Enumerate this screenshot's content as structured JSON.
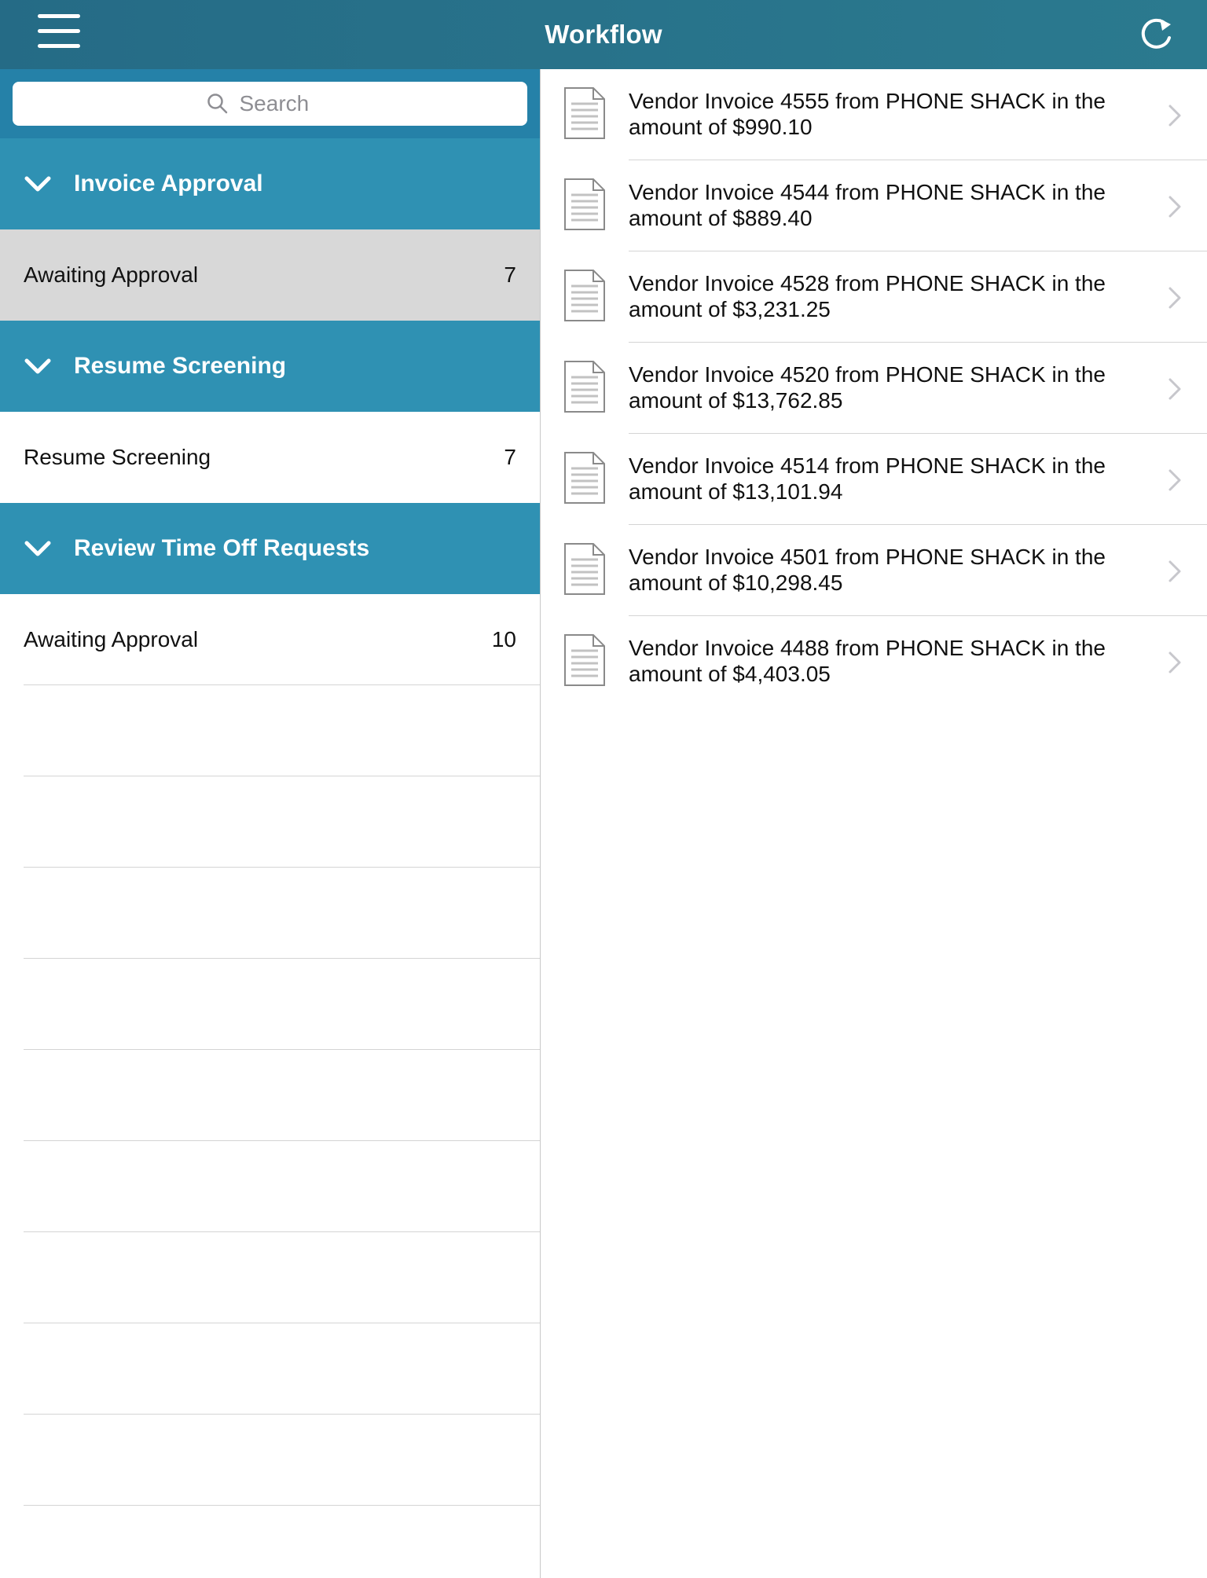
{
  "header": {
    "title": "Workflow",
    "menu_icon": "hamburger-menu-icon",
    "refresh_icon": "refresh-icon"
  },
  "colors": {
    "header": "#256b86",
    "search_bar": "#2581a8",
    "group_header": "#2f91b3",
    "selected_row": "#d8d8d8"
  },
  "sidebar": {
    "search": {
      "placeholder": "Search"
    },
    "groups": [
      {
        "label": "Invoice Approval",
        "items": [
          {
            "label": "Awaiting Approval",
            "count": "7",
            "selected": true
          }
        ]
      },
      {
        "label": "Resume Screening",
        "items": [
          {
            "label": "Resume Screening",
            "count": "7",
            "selected": false
          }
        ]
      },
      {
        "label": "Review Time Off Requests",
        "items": [
          {
            "label": "Awaiting Approval",
            "count": "10",
            "selected": false
          }
        ]
      }
    ]
  },
  "invoices": [
    {
      "line1": "Vendor Invoice 4555 from PHONE SHACK in the",
      "line2": "amount of $990.10"
    },
    {
      "line1": "Vendor Invoice 4544 from PHONE SHACK in the",
      "line2": "amount of $889.40"
    },
    {
      "line1": "Vendor Invoice 4528 from PHONE SHACK in the",
      "line2": "amount of $3,231.25"
    },
    {
      "line1": "Vendor Invoice 4520 from PHONE SHACK in the",
      "line2": "amount of $13,762.85"
    },
    {
      "line1": "Vendor Invoice 4514 from PHONE SHACK in the",
      "line2": "amount of $13,101.94"
    },
    {
      "line1": "Vendor Invoice 4501 from PHONE SHACK in the",
      "line2": "amount of $10,298.45"
    },
    {
      "line1": "Vendor Invoice 4488 from PHONE SHACK in the",
      "line2": "amount of $4,403.05"
    }
  ]
}
